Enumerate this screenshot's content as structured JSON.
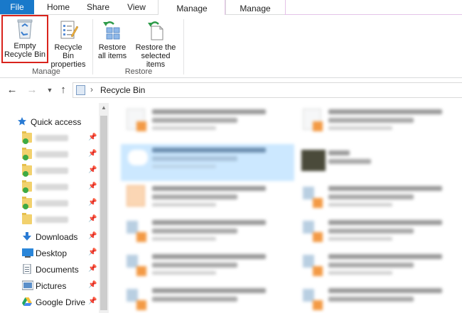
{
  "ribbon_tabs": {
    "file": "File",
    "home": "Home",
    "share": "Share",
    "view": "View",
    "manage_tools": "Manage",
    "manage": "Manage"
  },
  "ribbon": {
    "empty_recycle_bin": "Empty Recycle Bin",
    "recycle_bin_properties": "Recycle Bin properties",
    "restore_all_items": "Restore all items",
    "restore_selected_items": "Restore the selected items",
    "group_manage": "Manage",
    "group_restore": "Restore"
  },
  "address": {
    "path": "Recycle Bin",
    "icon": "recycle-bin-icon"
  },
  "nav_pane": {
    "quick_access": "Quick access",
    "items": [
      {
        "label": "",
        "icon": "folder-icon",
        "pinned": true
      },
      {
        "label": "",
        "icon": "folder-icon",
        "pinned": true
      },
      {
        "label": "",
        "icon": "folder-icon",
        "pinned": true
      },
      {
        "label": "",
        "icon": "folder-icon",
        "pinned": true
      },
      {
        "label": "",
        "icon": "folder-icon",
        "pinned": true
      },
      {
        "label": "",
        "icon": "folder-icon",
        "pinned": true
      },
      {
        "label": "Downloads",
        "icon": "download-arrow-icon",
        "pinned": true
      },
      {
        "label": "Desktop",
        "icon": "desktop-icon",
        "pinned": true
      },
      {
        "label": "Documents",
        "icon": "documents-icon",
        "pinned": true
      },
      {
        "label": "Pictures",
        "icon": "pictures-icon",
        "pinned": true
      },
      {
        "label": "Google Drive",
        "icon": "google-drive-icon",
        "pinned": true
      }
    ]
  },
  "colors": {
    "file_tab": "#1979ca",
    "highlight_border": "#d9231c",
    "selection": "#cce8ff",
    "manage_tools_accent": "#f6e28a",
    "manage_accent": "#e4c3e8"
  }
}
